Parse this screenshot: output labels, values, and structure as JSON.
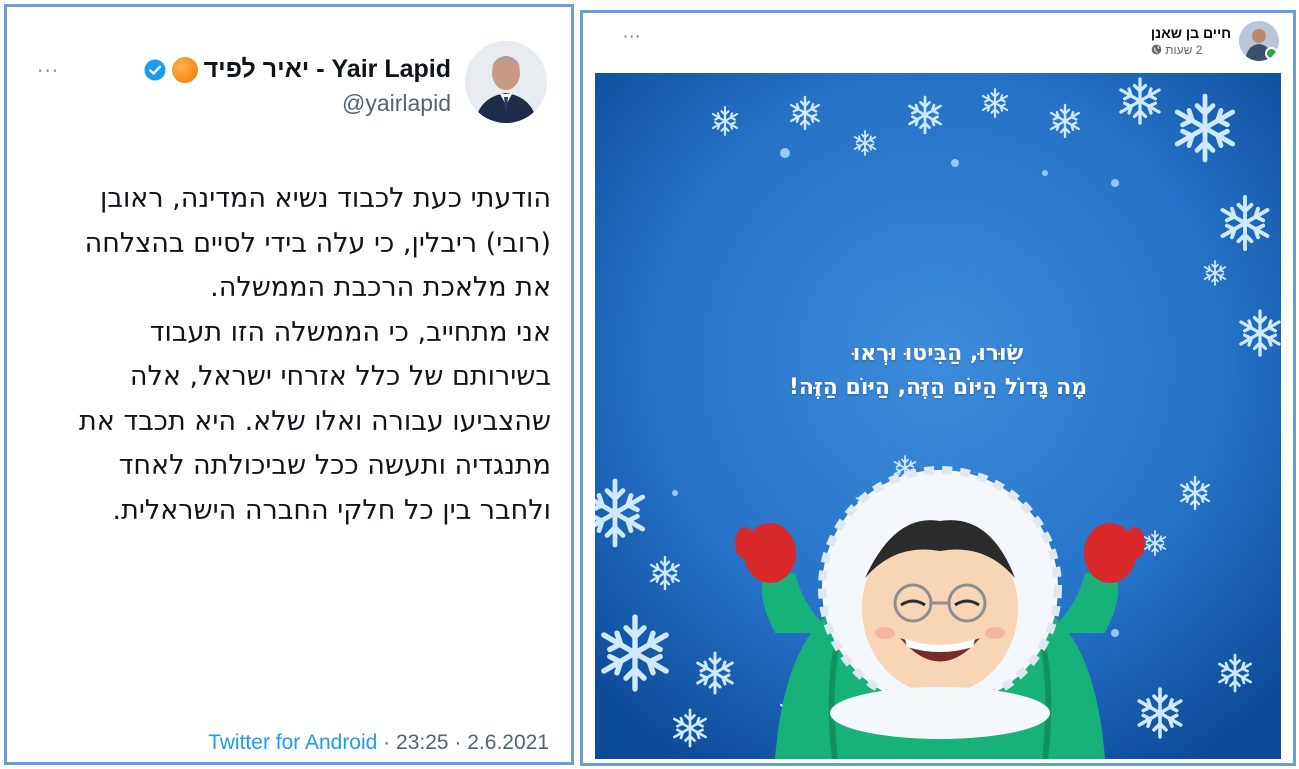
{
  "tweet": {
    "more_glyph": "···",
    "display_name": "יאיר לפיד - Yair Lapid",
    "handle": "@yairlapid",
    "paragraphs": [
      "הודעתי כעת לכבוד נשיא המדינה, ראובן (רובי) ריבלין, כי עלה בידי לסיים בהצלחה את מלאכת הרכבת הממשלה.",
      "אני מתחייב, כי הממשלה הזו תעבוד בשירותם של כלל אזרחי ישראל, אלה שהצביעו עבורה ואלו שלא. היא תכבד את מתנגדיה ותעשה ככל שביכולתה לאחד ולחבר בין כל חלקי החברה הישראלית."
    ],
    "footer_source": "Twitter for Android",
    "footer_time": "23:25",
    "footer_date": "2.6.2021",
    "footer_sep": " · ",
    "colors": {
      "link": "#1d9bf0",
      "verified": "#1d9bf0",
      "border": "#6a9fd6"
    }
  },
  "facebook": {
    "more_glyph": "···",
    "author": "חיים בן שאנן",
    "time": "2 שעות",
    "privacy_icon": "globe-icon",
    "caption_line1": "שִׂוּרוּ, הַבִּיטוּ וּרְאוּ",
    "caption_line2": "מָה גָּדוֹל הַיּוֹם הַזֶּה, הַיּוֹם הַזֶּה!",
    "image_colors": {
      "bg_center": "#2f7fd2",
      "bg_edge": "#0f4e9e",
      "jacket": "#17b27a",
      "mittens": "#d8282a"
    }
  }
}
